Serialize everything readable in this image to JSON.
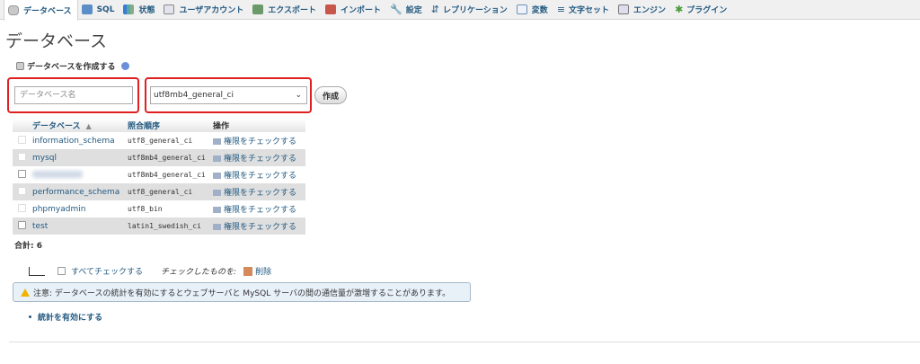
{
  "tabs": [
    {
      "label": "データベース",
      "icon": "database-icon",
      "active": true
    },
    {
      "label": "SQL",
      "icon": "sql-icon"
    },
    {
      "label": "状態",
      "icon": "status-icon"
    },
    {
      "label": "ユーザアカウント",
      "icon": "users-icon"
    },
    {
      "label": "エクスポート",
      "icon": "export-icon"
    },
    {
      "label": "インポート",
      "icon": "import-icon"
    },
    {
      "label": "設定",
      "icon": "wrench-icon"
    },
    {
      "label": "レプリケーション",
      "icon": "replication-icon"
    },
    {
      "label": "変数",
      "icon": "variables-icon"
    },
    {
      "label": "文字セット",
      "icon": "charset-icon"
    },
    {
      "label": "エンジン",
      "icon": "engine-icon"
    },
    {
      "label": "プラグイン",
      "icon": "plugin-icon"
    }
  ],
  "page_title": "データベース",
  "create": {
    "label": "データベースを作成する",
    "name_placeholder": "データベース名",
    "collation_value": "utf8mb4_general_ci",
    "create_button": "作成",
    "highlight_color": "#e02020"
  },
  "table": {
    "headers": {
      "database": "データベース",
      "collation": "照合順序",
      "action": "操作"
    },
    "rows": [
      {
        "name": "information_schema",
        "collation": "utf8_general_ci",
        "action": "権限をチェックする",
        "checkable": false
      },
      {
        "name": "mysql",
        "collation": "utf8mb4_general_ci",
        "action": "権限をチェックする",
        "checkable": false
      },
      {
        "name": "",
        "collation": "utf8mb4_general_ci",
        "action": "権限をチェックする",
        "checkable": true,
        "blurred": true
      },
      {
        "name": "performance_schema",
        "collation": "utf8_general_ci",
        "action": "権限をチェックする",
        "checkable": false
      },
      {
        "name": "phpmyadmin",
        "collation": "utf8_bin",
        "action": "権限をチェックする",
        "checkable": false
      },
      {
        "name": "test",
        "collation": "latin1_swedish_ci",
        "action": "権限をチェックする",
        "checkable": true
      }
    ],
    "total": "合計: 6"
  },
  "bulk": {
    "check_all": "すべてチェックする",
    "with_selected": "チェックしたものを:",
    "delete": "削除"
  },
  "notice": "注意: データベースの統計を有効にするとウェブサーバと MySQL サーバの間の通信量が激増することがあります。",
  "enable_stats": "統計を有効にする"
}
